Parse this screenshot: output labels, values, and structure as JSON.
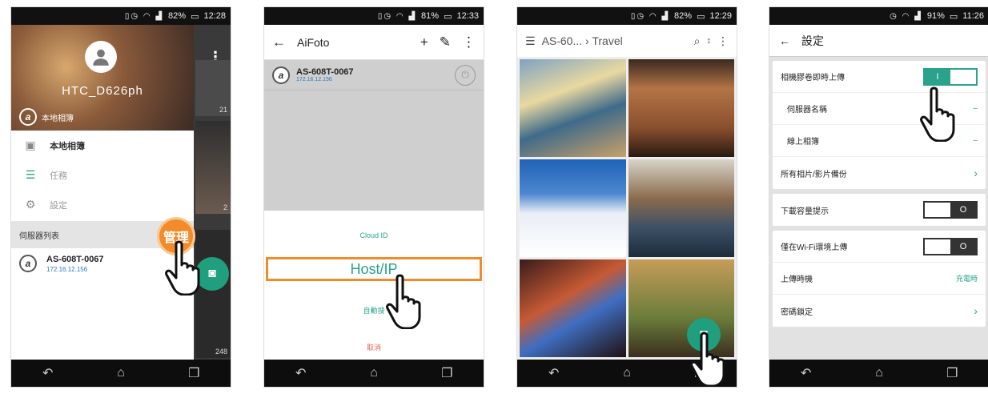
{
  "phone1": {
    "status": {
      "battery": "82%",
      "time": "12:28"
    },
    "username": "HTC_D626ph",
    "header_album": "本地相簿",
    "menu": [
      {
        "label": "本地相簿",
        "icon": "sd-card-icon"
      },
      {
        "label": "任務",
        "icon": "list-icon"
      },
      {
        "label": "設定",
        "icon": "gear-icon"
      }
    ],
    "server_section": "伺服器列表",
    "manage_label": "管理",
    "server": {
      "name": "AS-608T-0067",
      "ip": "172.16.12.156"
    },
    "bg_counts": [
      "21",
      "2",
      "248"
    ]
  },
  "phone2": {
    "status": {
      "battery": "81%",
      "time": "12:33"
    },
    "title": "AiFoto",
    "server": {
      "name": "AS-608T-0067",
      "ip": "172.16.12.156"
    },
    "options": {
      "cloud_id": "Cloud ID",
      "host_ip": "Host/IP",
      "auto_search": "自動搜",
      "cancel": "取消"
    }
  },
  "phone3": {
    "status": {
      "battery": "82%",
      "time": "12:29"
    },
    "breadcrumb": "AS-60...",
    "folder": "Travel"
  },
  "phone4": {
    "status": {
      "battery": "91%",
      "time": "11:26"
    },
    "title": "設定",
    "rows": {
      "instant_upload": "相機膠卷即時上傳",
      "server_name": "伺服器名稱",
      "online_album": "線上相簿",
      "dash": "–",
      "backup_all": "所有相片/影片備份",
      "download_alert": "下載容量提示",
      "wifi_only": "僅在Wi-Fi環境上傳",
      "upload_timing": "上傳時機",
      "upload_timing_value": "充電時",
      "password_lock": "密碼鎖定"
    }
  }
}
